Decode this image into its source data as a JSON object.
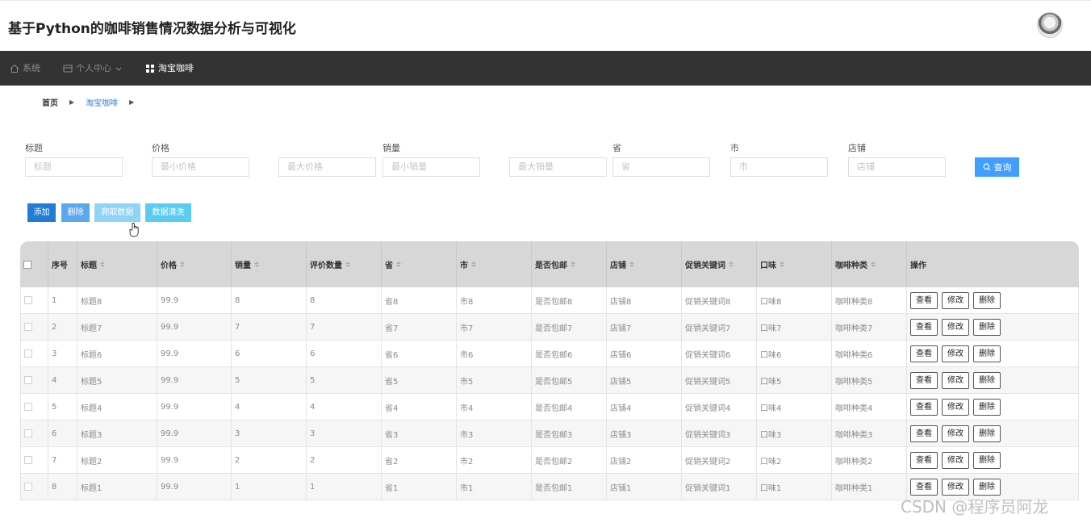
{
  "header": {
    "title": "基于Python的咖啡销售情况数据分析与可视化"
  },
  "nav": {
    "items": [
      {
        "label": "系统",
        "icon": "home-icon"
      },
      {
        "label": "个人中心",
        "icon": "card-icon"
      },
      {
        "label": "淘宝咖啡",
        "icon": "grid-icon"
      }
    ],
    "active_index": 2
  },
  "breadcrumb": {
    "home": "首页",
    "current": "淘宝咖啡"
  },
  "filters": {
    "title_label": "标题",
    "title_placeholder": "标题",
    "price_label": "价格",
    "price_min_placeholder": "最小价格",
    "price_max_placeholder": "最大价格",
    "sales_label": "销量",
    "sales_min_placeholder": "最小销量",
    "sales_max_placeholder": "最大销量",
    "province_label": "省",
    "province_placeholder": "省",
    "city_label": "市",
    "city_placeholder": "市",
    "shop_label": "店铺",
    "shop_placeholder": "店铺",
    "search_label": "查询"
  },
  "actions": {
    "add": "添加",
    "delete": "删除",
    "crawl": "爬取数据",
    "clean": "数据清洗"
  },
  "colors": {
    "primary": "#409eff",
    "add": "#1f7dd6",
    "delete": "#5aa9f0",
    "crawl": "#8fd3f5",
    "clean": "#5ccbf2",
    "navbar": "#333333"
  },
  "table": {
    "columns": [
      "序号",
      "标题",
      "价格",
      "销量",
      "评价数量",
      "省",
      "市",
      "是否包邮",
      "店铺",
      "促销关键词",
      "口味",
      "咖啡种类",
      "操作"
    ],
    "rows": [
      [
        "1",
        "标题8",
        "99.9",
        "8",
        "8",
        "省8",
        "市8",
        "是否包邮8",
        "店铺8",
        "促销关键词8",
        "口味8",
        "咖啡种类8"
      ],
      [
        "2",
        "标题7",
        "99.9",
        "7",
        "7",
        "省7",
        "市7",
        "是否包邮7",
        "店铺7",
        "促销关键词7",
        "口味7",
        "咖啡种类7"
      ],
      [
        "3",
        "标题6",
        "99.9",
        "6",
        "6",
        "省6",
        "市6",
        "是否包邮6",
        "店铺6",
        "促销关键词6",
        "口味6",
        "咖啡种类6"
      ],
      [
        "4",
        "标题5",
        "99.9",
        "5",
        "5",
        "省5",
        "市5",
        "是否包邮5",
        "店铺5",
        "促销关键词5",
        "口味5",
        "咖啡种类5"
      ],
      [
        "5",
        "标题4",
        "99.9",
        "4",
        "4",
        "省4",
        "市4",
        "是否包邮4",
        "店铺4",
        "促销关键词4",
        "口味4",
        "咖啡种类4"
      ],
      [
        "6",
        "标题3",
        "99.9",
        "3",
        "3",
        "省3",
        "市3",
        "是否包邮3",
        "店铺3",
        "促销关键词3",
        "口味3",
        "咖啡种类3"
      ],
      [
        "7",
        "标题2",
        "99.9",
        "2",
        "2",
        "省2",
        "市2",
        "是否包邮2",
        "店铺2",
        "促销关键词2",
        "口味2",
        "咖啡种类2"
      ],
      [
        "8",
        "标题1",
        "99.9",
        "1",
        "1",
        "省1",
        "市1",
        "是否包邮1",
        "店铺1",
        "促销关键词1",
        "口味1",
        "咖啡种类1"
      ]
    ],
    "row_actions": [
      "查看",
      "修改",
      "删除"
    ]
  },
  "watermark": "CSDN @程序员阿龙"
}
